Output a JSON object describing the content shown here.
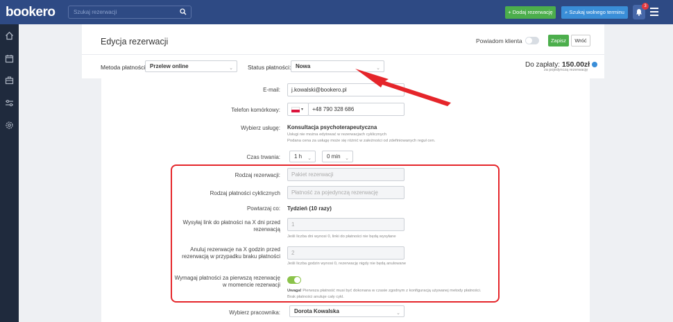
{
  "brand": {
    "logo": "bookero"
  },
  "topbar": {
    "search_placeholder": "Szukaj rezerwacji",
    "add_booking": "+ Dodaj rezerwację",
    "find_free": "Szukaj wolnego terminu",
    "notifications_count": "3"
  },
  "sidebar": {
    "icons": [
      "home-icon",
      "calendar-icon",
      "briefcase-icon",
      "sliders-icon",
      "gear-icon"
    ]
  },
  "header": {
    "title": "Edycja rezerwacji",
    "notify_label": "Powiadom klienta",
    "notify_on": false,
    "save": "Zapisz",
    "back": "Wróć",
    "payment_method_label": "Metoda płatności:",
    "payment_method_value": "Przelew online",
    "payment_status_label": "Status płatności:",
    "payment_status_value": "Nowa",
    "to_pay_label": "Do zapłaty:",
    "to_pay_value": "150.00zł",
    "to_pay_sub": "za pojedynczą rezerwację"
  },
  "form": {
    "email_label": "E-mail:",
    "email_value": "j.kowalski@bookero.pl",
    "phone_label": "Telefon komórkowy:",
    "phone_value": "+48 790 328 686",
    "service_label": "Wybierz usługę:",
    "service_value": "Konsultacja psychoterapeutyczna",
    "service_note1": "Usługi nie można edytować w rezerwacjach cyklicznych",
    "service_note2": "Podana cena za usługę może się różnić w zależności od zdefiniowanych reguł cen.",
    "duration_label": "Czas trwania:",
    "duration_h": "1 h",
    "duration_min": "0 min",
    "booking_type_label": "Rodzaj rezerwacji:",
    "booking_type_value": "Pakiet rezerwacji",
    "cyclic_payment_label": "Rodzaj płatności cyklicznych",
    "cyclic_payment_value": "Płatność za pojedynczą rezerwację",
    "repeat_label": "Powtarzaj co:",
    "repeat_value": "Tydzień  (10 razy)",
    "send_link_label": "Wysyłaj link do płatności na X dni przed rezerwacją",
    "send_link_value": "1",
    "send_link_note": "Jeśli liczba dni wynosi 0, linki do płatności nie będą wysyłane",
    "cancel_label": "Anuluj rezerwacje na X godzin przed rezerwacją w przypadku braku płatności",
    "cancel_value": "2",
    "cancel_note": "Jeśli liczba godzin wynosi 0, rezerwację nigdy nie będą anulowane",
    "require_first_label": "Wymagaj płatności za pierwszą rezerwację w momencie rezerwacji",
    "require_first_on": true,
    "warning_bold": "Uwaga!",
    "warning_text": " Pierwsza płatność musi być dokonana w czasie zgodnym z konfiguracją używanej metody płatności.",
    "warning_text2": "Brak płatności anuluje cały cykl.",
    "employee_label": "Wybierz pracownika:",
    "employee_value": "Dorota Kowalska"
  },
  "colors": {
    "topbar": "#2e4a84",
    "sidebar": "#1f2a3d",
    "green": "#4cae4c",
    "blue": "#3a8ed8",
    "annotation": "#e5252a"
  }
}
